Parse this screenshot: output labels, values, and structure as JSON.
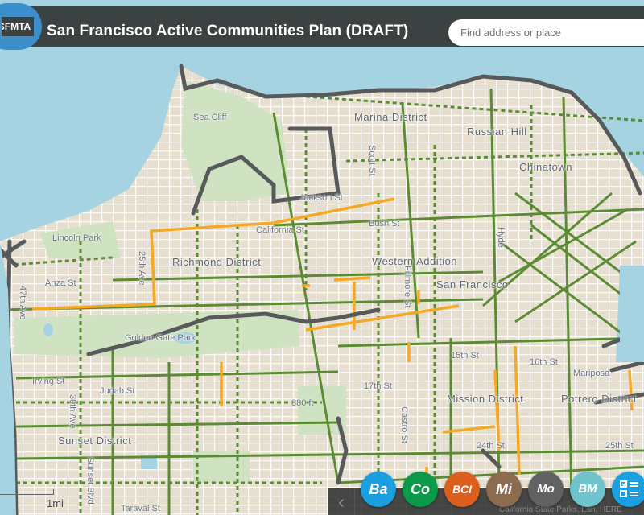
{
  "header": {
    "logo_text": "SFMTA",
    "title": "San Francisco Active Communities Plan (DRAFT)"
  },
  "search": {
    "placeholder": "Find address or place"
  },
  "map": {
    "colors": {
      "water": "#a6d3e2",
      "land": "#e6dfcf",
      "park": "#cfe3c2",
      "street": "#ffffff",
      "route_green": "#5b8c33",
      "route_orange": "#f7a823",
      "route_gray": "#58595b"
    },
    "labels": [
      "Sea Cliff",
      "Marina District",
      "Russian Hill",
      "Chinatown",
      "Jackson St",
      "California St",
      "Bush St",
      "Lincoln Park",
      "Richmond District",
      "Western Addition",
      "San Francisco",
      "25th Ave",
      "Anza St",
      "47th Ave",
      "Golden Gate Park",
      "Irving St",
      "Judah St",
      "39th Ave",
      "Sunset District",
      "Sunset Blvd",
      "Taraval St",
      "880 ft",
      "17th St",
      "15th St",
      "Castro St",
      "Mission District",
      "Potrero District",
      "24th St",
      "25th St",
      "Mariposa",
      "Fillmore St",
      "Scott St",
      "Hyde",
      "16th St"
    ],
    "scale_label": "1mi",
    "attribution": "California State Parks, Esri, HERE"
  },
  "layer_buttons": [
    {
      "label": "Ba",
      "color": "#1a9fe0"
    },
    {
      "label": "Co",
      "color": "#0a9a4a"
    },
    {
      "label": "BCI",
      "color": "#dd5f1d"
    },
    {
      "label": "Mi",
      "color": "#8b6c4e"
    },
    {
      "label": "Mo",
      "color": "#616264"
    },
    {
      "label": "BM",
      "color": "#6fc3cc"
    },
    {
      "label": "",
      "icon": "checklist-icon",
      "color": "#1a9fe0"
    }
  ],
  "bottom_bar": {
    "collapse_icon": "chevron-left-icon"
  }
}
